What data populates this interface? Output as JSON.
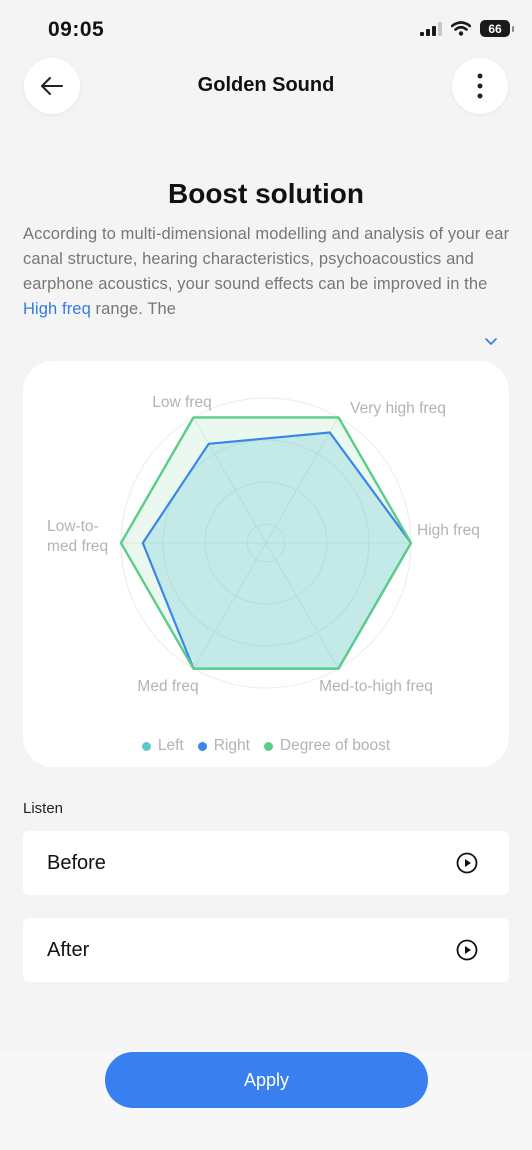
{
  "status_bar": {
    "time": "09:05",
    "battery": "66"
  },
  "header": {
    "title": "Golden Sound",
    "back_icon": "arrow-left-icon",
    "more_icon": "more-vertical-icon"
  },
  "boost": {
    "title": "Boost solution",
    "description_before": "According to multi-dimensional modelling and analysis of your ear canal structure, hearing characteristics, psychoacoustics and earphone acoustics, your sound effects can be improved in the ",
    "description_highlight": "High freq",
    "description_after": " range. The"
  },
  "chart_data": {
    "type": "radar",
    "axes": [
      "Low freq",
      "Very high freq",
      "High freq",
      "Med-to-high freq",
      "Med freq",
      "Low-to-med freq"
    ],
    "axis_label_lines": [
      [
        "Low freq"
      ],
      [
        "Very high freq"
      ],
      [
        "High freq"
      ],
      [
        "Med-to-high freq"
      ],
      [
        "Med freq"
      ],
      [
        "Low-to-",
        "med freq"
      ]
    ],
    "range": [
      0,
      1
    ],
    "series": [
      {
        "name": "Left",
        "values": [
          0.79,
          0.88,
          1.0,
          1.0,
          1.0,
          0.85
        ],
        "color": "#5cc6d0"
      },
      {
        "name": "Right",
        "values": [
          0.79,
          0.88,
          1.0,
          1.0,
          1.0,
          0.85
        ],
        "color": "#3a86e8"
      },
      {
        "name": "Degree of boost",
        "values": [
          1.0,
          1.0,
          1.0,
          1.0,
          1.0,
          1.0
        ],
        "color": "#5ccc8a"
      }
    ],
    "legend_position": "bottom-center",
    "grid": true
  },
  "listen": {
    "label": "Listen",
    "items": [
      {
        "label": "Before",
        "icon": "play-circle-icon"
      },
      {
        "label": "After",
        "icon": "play-circle-icon"
      }
    ]
  },
  "apply": {
    "label": "Apply"
  },
  "colors": {
    "accent": "#3a7ff0",
    "link": "#2f7de1"
  }
}
